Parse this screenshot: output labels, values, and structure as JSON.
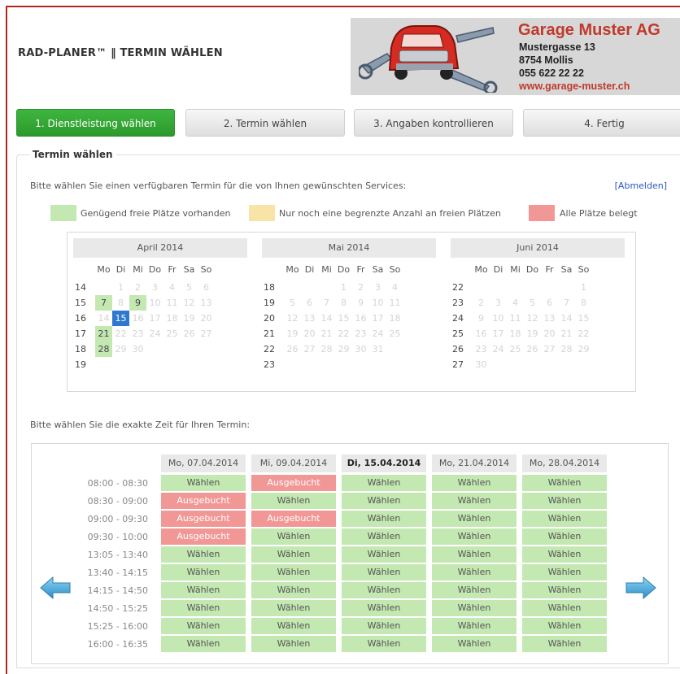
{
  "app": {
    "title": "RAD-PLANER™ ‖ TERMIN WÄHLEN"
  },
  "company": {
    "name": "Garage Muster AG",
    "street": "Mustergasse 13",
    "city": "8754 Mollis",
    "phone": "055 622 22 22",
    "web": "www.garage-muster.ch"
  },
  "steps": [
    {
      "label": "1. Dienstleistung wählen",
      "active": true
    },
    {
      "label": "2. Termin wählen",
      "active": false
    },
    {
      "label": "3. Angaben kontrollieren",
      "active": false
    },
    {
      "label": "4. Fertig",
      "active": false
    }
  ],
  "section": {
    "legend": "Termin wählen",
    "intro": "Bitte wählen Sie einen verfügbaren Termin für die von Ihnen gewünschten Services:",
    "logout": "[Abmelden]"
  },
  "legend_items": [
    {
      "label": "Genügend freie Plätze vorhanden",
      "color": "#c4e8b2"
    },
    {
      "label": "Nur noch eine begrenzte Anzahl an freien Plätzen",
      "color": "#f8e4a6"
    },
    {
      "label": "Alle Plätze belegt",
      "color": "#f19896"
    }
  ],
  "colors": {
    "free": "#c4e8b2",
    "booked": "#f19896",
    "selected": "#2e79cf",
    "accent": "#c0392b",
    "step_active": "#34a834"
  },
  "calendar": {
    "weekdays": [
      "Mo",
      "Di",
      "Mi",
      "Do",
      "Fr",
      "Sa",
      "So"
    ],
    "months": [
      {
        "name": "April 2014",
        "weeks": [
          "14",
          "15",
          "16",
          "17",
          "18",
          "19"
        ],
        "rows": [
          [
            "",
            "1",
            "2",
            "3",
            "4",
            "5",
            "6"
          ],
          [
            "7",
            "8",
            "9",
            "10",
            "11",
            "12",
            "13"
          ],
          [
            "14",
            "15",
            "16",
            "17",
            "18",
            "19",
            "20"
          ],
          [
            "21",
            "22",
            "23",
            "24",
            "25",
            "26",
            "27"
          ],
          [
            "28",
            "29",
            "30",
            "",
            "",
            "",
            ""
          ],
          [
            "",
            "",
            "",
            "",
            "",
            "",
            ""
          ]
        ],
        "available": [
          "7",
          "9",
          "21",
          "28"
        ],
        "selected": "15"
      },
      {
        "name": "Mai 2014",
        "weeks": [
          "18",
          "19",
          "20",
          "21",
          "22",
          "23"
        ],
        "rows": [
          [
            "",
            "",
            "",
            "1",
            "2",
            "3",
            "4"
          ],
          [
            "5",
            "6",
            "7",
            "8",
            "9",
            "10",
            "11"
          ],
          [
            "12",
            "13",
            "14",
            "15",
            "16",
            "17",
            "18"
          ],
          [
            "19",
            "20",
            "21",
            "22",
            "23",
            "24",
            "25"
          ],
          [
            "26",
            "27",
            "28",
            "29",
            "30",
            "31",
            ""
          ],
          [
            "",
            "",
            "",
            "",
            "",
            "",
            ""
          ]
        ],
        "available": [],
        "selected": ""
      },
      {
        "name": "Juni 2014",
        "weeks": [
          "22",
          "23",
          "24",
          "25",
          "26",
          "27"
        ],
        "rows": [
          [
            "",
            "",
            "",
            "",
            "",
            "",
            "1"
          ],
          [
            "2",
            "3",
            "4",
            "5",
            "6",
            "7",
            "8"
          ],
          [
            "9",
            "10",
            "11",
            "12",
            "13",
            "14",
            "15"
          ],
          [
            "16",
            "17",
            "18",
            "19",
            "20",
            "21",
            "22"
          ],
          [
            "23",
            "24",
            "25",
            "26",
            "27",
            "28",
            "29"
          ],
          [
            "30",
            "",
            "",
            "",
            "",
            "",
            ""
          ]
        ],
        "available": [],
        "selected": ""
      }
    ]
  },
  "times": {
    "intro": "Bitte wählen Sie die exakte Zeit für Ihren Termin:",
    "columns": [
      {
        "label": "Mo, 07.04.2014",
        "bold": false
      },
      {
        "label": "Mi, 09.04.2014",
        "bold": false
      },
      {
        "label": "Di, 15.04.2014",
        "bold": true
      },
      {
        "label": "Mo, 21.04.2014",
        "bold": false
      },
      {
        "label": "Mo, 28.04.2014",
        "bold": false
      }
    ],
    "slots": [
      "08:00 - 08:30",
      "08:30 - 09:00",
      "09:00 - 09:30",
      "09:30 - 10:00",
      "13:05 - 13:40",
      "13:40 - 14:15",
      "14:15 - 14:50",
      "14:50 - 15:25",
      "15:25 - 16:00",
      "16:00 - 16:35"
    ],
    "choose_label": "Wählen",
    "booked_label": "Ausgebucht",
    "booked": [
      [
        false,
        true,
        true,
        true,
        false,
        false,
        false,
        false,
        false,
        false
      ],
      [
        true,
        false,
        true,
        false,
        false,
        false,
        false,
        false,
        false,
        false
      ],
      [
        false,
        false,
        false,
        false,
        false,
        false,
        false,
        false,
        false,
        false
      ],
      [
        false,
        false,
        false,
        false,
        false,
        false,
        false,
        false,
        false,
        false
      ],
      [
        false,
        false,
        false,
        false,
        false,
        false,
        false,
        false,
        false,
        false
      ]
    ]
  },
  "icons": {
    "prev": "arrow-left-icon",
    "next": "arrow-right-icon",
    "logo": "car-wrench-logo"
  }
}
